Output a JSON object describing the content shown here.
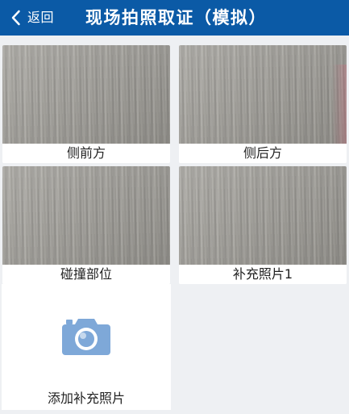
{
  "header": {
    "back_label": "返回",
    "title": "现场拍照取证（模拟）"
  },
  "photos": [
    {
      "caption": "侧前方"
    },
    {
      "caption": "侧后方"
    },
    {
      "caption": "碰撞部位"
    },
    {
      "caption": "补充照片1"
    }
  ],
  "add_photo": {
    "label": "添加补充照片",
    "icon": "camera-icon"
  },
  "icons": {
    "back": "chevron-left-icon",
    "camera": "camera-icon"
  },
  "colors": {
    "header_bg": "#0b5aa6",
    "header_text": "#ffffff",
    "page_bg": "#eef0f3",
    "card_bg": "#ffffff",
    "camera_icon": "#7ea8d8",
    "text": "#222222"
  }
}
